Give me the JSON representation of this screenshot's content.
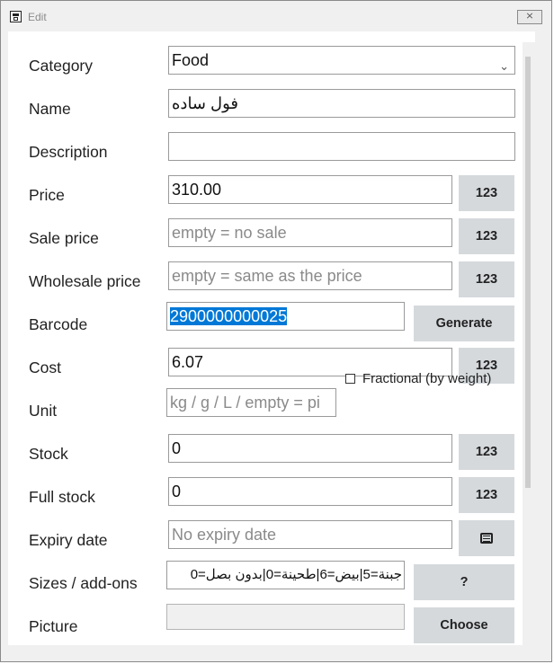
{
  "window": {
    "title": "Edit",
    "close_label": "⨯"
  },
  "form": {
    "category": {
      "label": "Category",
      "value": "Food"
    },
    "name": {
      "label": "Name",
      "value": "فول ساده"
    },
    "description": {
      "label": "Description",
      "value": ""
    },
    "price": {
      "label": "Price",
      "value": "310.00",
      "button": "123"
    },
    "sale_price": {
      "label": "Sale price",
      "placeholder": "empty = no sale",
      "button": "123"
    },
    "wholesale_price": {
      "label": "Wholesale price",
      "placeholder": "empty = same as the price",
      "button": "123"
    },
    "barcode": {
      "label": "Barcode",
      "value": "2900000000025",
      "button": "Generate"
    },
    "cost": {
      "label": "Cost",
      "value": "6.07",
      "button": "123"
    },
    "unit": {
      "label": "Unit",
      "placeholder": "kg / g / L / empty = pi",
      "checkbox_label": "Fractional (by weight)",
      "checked": false
    },
    "stock": {
      "label": "Stock",
      "value": "0",
      "button": "123"
    },
    "full_stock": {
      "label": "Full stock",
      "value": "0",
      "button": "123"
    },
    "expiry_date": {
      "label": "Expiry date",
      "placeholder": "No expiry date",
      "icon": "calendar-icon"
    },
    "sizes_addons": {
      "label": "Sizes / add-ons",
      "value": "جبنة=5|بيض=6|طحينة=0|بدون بصل=0",
      "button": "?"
    },
    "picture": {
      "label": "Picture",
      "value": "",
      "button": "Choose"
    }
  }
}
